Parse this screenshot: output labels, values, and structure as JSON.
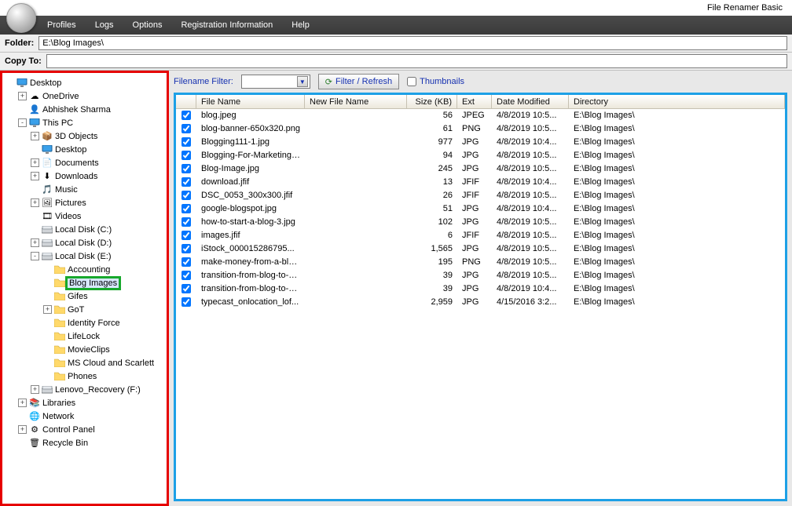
{
  "app": {
    "title": "File Renamer Basic"
  },
  "menu": {
    "profiles": "Profiles",
    "logs": "Logs",
    "options": "Options",
    "reg": "Registration Information",
    "help": "Help"
  },
  "path": {
    "folder_label": "Folder:",
    "folder_value": "E:\\Blog Images\\",
    "copyto_label": "Copy To:",
    "copyto_value": ""
  },
  "filter": {
    "label": "Filename Filter:",
    "btn": "Filter / Refresh",
    "thumb": "Thumbnails"
  },
  "headers": {
    "name": "File Name",
    "new": "New File Name",
    "size": "Size (KB)",
    "ext": "Ext",
    "date": "Date Modified",
    "dir": "Directory"
  },
  "tree": [
    {
      "ind": 0,
      "ex": "",
      "icon": "monitor",
      "label": "Desktop"
    },
    {
      "ind": 1,
      "ex": "+",
      "icon": "onedrive",
      "label": "OneDrive"
    },
    {
      "ind": 1,
      "ex": "",
      "icon": "user",
      "label": "Abhishek Sharma"
    },
    {
      "ind": 1,
      "ex": "-",
      "icon": "pc",
      "label": "This PC"
    },
    {
      "ind": 2,
      "ex": "+",
      "icon": "folder3d",
      "label": "3D Objects"
    },
    {
      "ind": 2,
      "ex": "",
      "icon": "monitor",
      "label": "Desktop"
    },
    {
      "ind": 2,
      "ex": "+",
      "icon": "docs",
      "label": "Documents"
    },
    {
      "ind": 2,
      "ex": "+",
      "icon": "down",
      "label": "Downloads"
    },
    {
      "ind": 2,
      "ex": "",
      "icon": "music",
      "label": "Music"
    },
    {
      "ind": 2,
      "ex": "+",
      "icon": "pics",
      "label": "Pictures"
    },
    {
      "ind": 2,
      "ex": "",
      "icon": "video",
      "label": "Videos"
    },
    {
      "ind": 2,
      "ex": "",
      "icon": "drive",
      "label": "Local Disk (C:)"
    },
    {
      "ind": 2,
      "ex": "+",
      "icon": "drive",
      "label": "Local Disk (D:)"
    },
    {
      "ind": 2,
      "ex": "-",
      "icon": "drive",
      "label": "Local Disk (E:)"
    },
    {
      "ind": 3,
      "ex": "",
      "icon": "folder",
      "label": "Accounting"
    },
    {
      "ind": 3,
      "ex": "",
      "icon": "folder",
      "label": "Blog Images",
      "sel": true
    },
    {
      "ind": 3,
      "ex": "",
      "icon": "folder",
      "label": "Gifes"
    },
    {
      "ind": 3,
      "ex": "+",
      "icon": "folder",
      "label": "GoT"
    },
    {
      "ind": 3,
      "ex": "",
      "icon": "folder",
      "label": "Identity Force"
    },
    {
      "ind": 3,
      "ex": "",
      "icon": "folder",
      "label": "LifeLock"
    },
    {
      "ind": 3,
      "ex": "",
      "icon": "folder",
      "label": "MovieClips"
    },
    {
      "ind": 3,
      "ex": "",
      "icon": "folder",
      "label": "MS Cloud and Scarlett"
    },
    {
      "ind": 3,
      "ex": "",
      "icon": "folder",
      "label": "Phones"
    },
    {
      "ind": 2,
      "ex": "+",
      "icon": "drive",
      "label": "Lenovo_Recovery (F:)"
    },
    {
      "ind": 1,
      "ex": "+",
      "icon": "lib",
      "label": "Libraries"
    },
    {
      "ind": 1,
      "ex": "",
      "icon": "net",
      "label": "Network"
    },
    {
      "ind": 1,
      "ex": "+",
      "icon": "cp",
      "label": "Control Panel"
    },
    {
      "ind": 1,
      "ex": "",
      "icon": "bin",
      "label": "Recycle Bin"
    }
  ],
  "rows": [
    {
      "name": "blog.jpeg",
      "size": "56",
      "ext": "JPEG",
      "date": "4/8/2019 10:5...",
      "dir": "E:\\Blog Images\\"
    },
    {
      "name": "blog-banner-650x320.png",
      "size": "61",
      "ext": "PNG",
      "date": "4/8/2019 10:5...",
      "dir": "E:\\Blog Images\\"
    },
    {
      "name": "Blogging111-1.jpg",
      "size": "977",
      "ext": "JPG",
      "date": "4/8/2019 10:4...",
      "dir": "E:\\Blog Images\\"
    },
    {
      "name": "Blogging-For-Marketing-...",
      "size": "94",
      "ext": "JPG",
      "date": "4/8/2019 10:5...",
      "dir": "E:\\Blog Images\\"
    },
    {
      "name": "Blog-Image.jpg",
      "size": "245",
      "ext": "JPG",
      "date": "4/8/2019 10:5...",
      "dir": "E:\\Blog Images\\"
    },
    {
      "name": "download.jfif",
      "size": "13",
      "ext": "JFIF",
      "date": "4/8/2019 10:4...",
      "dir": "E:\\Blog Images\\"
    },
    {
      "name": "DSC_0053_300x300.jfif",
      "size": "26",
      "ext": "JFIF",
      "date": "4/8/2019 10:5...",
      "dir": "E:\\Blog Images\\"
    },
    {
      "name": "google-blogspot.jpg",
      "size": "51",
      "ext": "JPG",
      "date": "4/8/2019 10:4...",
      "dir": "E:\\Blog Images\\"
    },
    {
      "name": "how-to-start-a-blog-3.jpg",
      "size": "102",
      "ext": "JPG",
      "date": "4/8/2019 10:5...",
      "dir": "E:\\Blog Images\\"
    },
    {
      "name": "images.jfif",
      "size": "6",
      "ext": "JFIF",
      "date": "4/8/2019 10:5...",
      "dir": "E:\\Blog Images\\"
    },
    {
      "name": "iStock_000015286795...",
      "size": "1,565",
      "ext": "JPG",
      "date": "4/8/2019 10:5...",
      "dir": "E:\\Blog Images\\"
    },
    {
      "name": "make-money-from-a-blo...",
      "size": "195",
      "ext": "PNG",
      "date": "4/8/2019 10:5...",
      "dir": "E:\\Blog Images\\"
    },
    {
      "name": "transition-from-blog-to-w...",
      "size": "39",
      "ext": "JPG",
      "date": "4/8/2019 10:5...",
      "dir": "E:\\Blog Images\\"
    },
    {
      "name": "transition-from-blog-to-w...",
      "size": "39",
      "ext": "JPG",
      "date": "4/8/2019 10:4...",
      "dir": "E:\\Blog Images\\"
    },
    {
      "name": "typecast_onlocation_lof...",
      "size": "2,959",
      "ext": "JPG",
      "date": "4/15/2016 3:2...",
      "dir": "E:\\Blog Images\\"
    }
  ],
  "icons": {
    "monitor": "🖥",
    "onedrive": "☁",
    "user": "👤",
    "pc": "💻",
    "folder3d": "📦",
    "docs": "📄",
    "down": "⬇",
    "music": "🎵",
    "pics": "🖼",
    "video": "🎞",
    "drive": "💽",
    "folder": "📁",
    "lib": "📚",
    "net": "🌐",
    "cp": "⚙",
    "bin": "🗑"
  }
}
